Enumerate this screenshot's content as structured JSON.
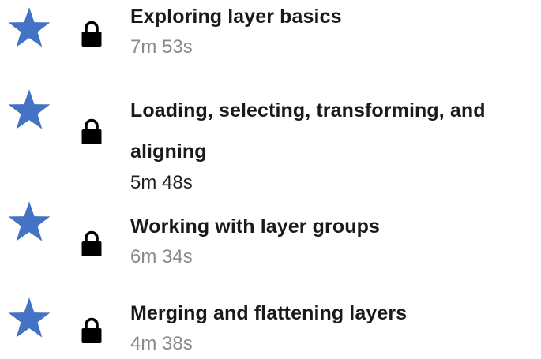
{
  "colors": {
    "star": "#4472c4",
    "lock": "#000000",
    "title": "#1a1a1a",
    "duration_muted": "#8a8a8a",
    "duration_dark": "#1f1f1f"
  },
  "items": [
    {
      "title": "Exploring layer basics",
      "duration": "7m 53s",
      "star_icon": "star-icon",
      "lock_icon": "lock-icon"
    },
    {
      "title": "Loading, selecting, transforming, and aligning",
      "duration": "5m 48s",
      "star_icon": "star-icon",
      "lock_icon": "lock-icon"
    },
    {
      "title": "Working with layer groups",
      "duration": "6m 34s",
      "star_icon": "star-icon",
      "lock_icon": "lock-icon"
    },
    {
      "title": "Merging and flattening layers",
      "duration": "4m 38s",
      "star_icon": "star-icon",
      "lock_icon": "lock-icon"
    }
  ]
}
